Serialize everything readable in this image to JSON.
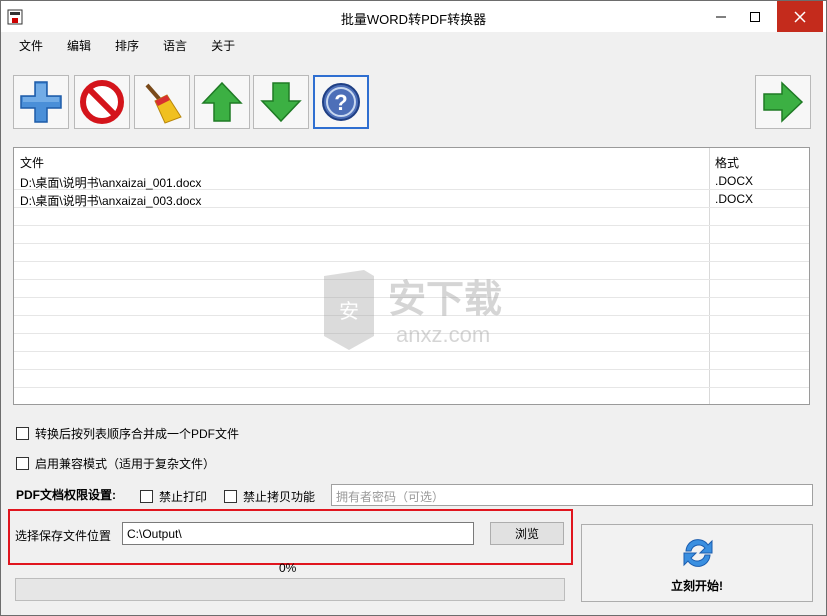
{
  "window": {
    "title": "批量WORD转PDF转换器"
  },
  "menu": [
    "文件",
    "编辑",
    "排序",
    "语言",
    "关于"
  ],
  "toolbar": [
    "add-icon",
    "delete-icon",
    "clear-icon",
    "move-up-icon",
    "move-down-icon",
    "help-icon",
    "next-icon"
  ],
  "file_list": {
    "columns": {
      "name": "文件",
      "format": "格式"
    },
    "rows": [
      {
        "name": "D:\\桌面\\说明书\\anxaizai_001.docx",
        "format": ".DOCX"
      },
      {
        "name": "D:\\桌面\\说明书\\anxaizai_003.docx",
        "format": ".DOCX"
      }
    ]
  },
  "watermark": {
    "main": "安下载",
    "sub": "anxz.com",
    "badge": "安"
  },
  "options": {
    "merge": "转换后按列表顺序合并成一个PDF文件",
    "compat": "启用兼容模式（适用于复杂文件）"
  },
  "permissions": {
    "label": "PDF文档权限设置:",
    "no_print": "禁止打印",
    "no_copy": "禁止拷贝功能",
    "password_placeholder": "拥有者密码（可选）"
  },
  "save": {
    "label": "选择保存文件位置",
    "path": "C:\\Output\\",
    "browse": "浏览"
  },
  "progress": {
    "text": "0%",
    "value": 0
  },
  "start": {
    "label": "立刻开始!"
  },
  "colors": {
    "accent_red": "#e0151e",
    "progress_green": "#06b025",
    "focus_blue": "#2f6fd1"
  }
}
